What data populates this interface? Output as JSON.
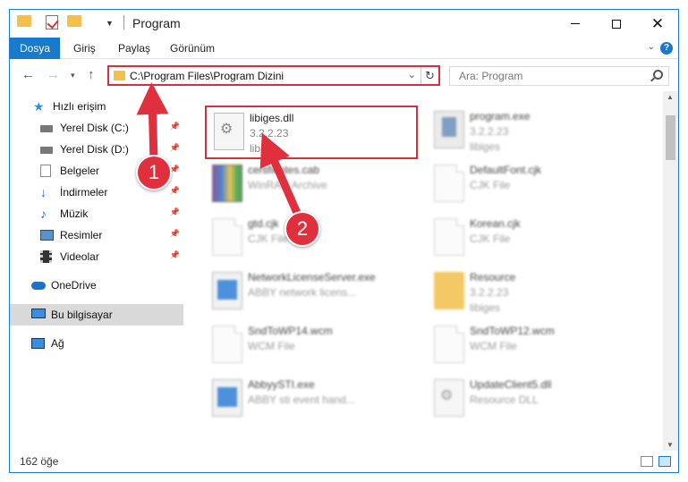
{
  "window": {
    "title": "Program"
  },
  "ribbon": {
    "tabs": [
      "Dosya",
      "Giriş",
      "Paylaş",
      "Görünüm"
    ]
  },
  "address": {
    "path": "C:\\Program Files\\Program Dizini",
    "search_placeholder": "Ara: Program"
  },
  "sidebar": {
    "items": [
      {
        "label": "Hızlı erişim",
        "icon": "star-icon"
      },
      {
        "label": "Yerel Disk (C:)",
        "icon": "drive-icon"
      },
      {
        "label": "Yerel Disk (D:)",
        "icon": "drive-icon"
      },
      {
        "label": "Belgeler",
        "icon": "documents-icon"
      },
      {
        "label": "İndirmeler",
        "icon": "download-icon"
      },
      {
        "label": "Müzik",
        "icon": "music-icon"
      },
      {
        "label": "Resimler",
        "icon": "pictures-icon"
      },
      {
        "label": "Videolar",
        "icon": "videos-icon"
      },
      {
        "label": "OneDrive",
        "icon": "cloud-icon"
      },
      {
        "label": "Bu bilgisayar",
        "icon": "computer-icon"
      },
      {
        "label": "Ağ",
        "icon": "network-icon"
      }
    ]
  },
  "files": [
    {
      "name": "libiges.dll",
      "line2": "3.2.2.23",
      "line3": "libiges",
      "icon": "dll-gear-icon"
    },
    {
      "name": "program.exe",
      "line2": "3.2.2.23",
      "line3": "libiges",
      "icon": "program-icon"
    },
    {
      "name": "certificates.cab",
      "line2": "WinRAR Archive",
      "line3": "",
      "icon": "archive-icon"
    },
    {
      "name": "DefaultFont.cjk",
      "line2": "CJK File",
      "line3": "",
      "icon": "document-icon"
    },
    {
      "name": "gtd.cjk",
      "line2": "CJK File",
      "line3": "",
      "icon": "document-icon"
    },
    {
      "name": "Korean.cjk",
      "line2": "CJK File",
      "line3": "",
      "icon": "document-icon"
    },
    {
      "name": "NetworkLicenseServer.exe",
      "line2": "ABBY network licens...",
      "line3": "",
      "icon": "exe-icon"
    },
    {
      "name": "Resource",
      "line2": "3.2.2.23",
      "line3": "libiges",
      "icon": "folder-icon"
    },
    {
      "name": "SndToWP14.wcm",
      "line2": "WCM File",
      "line3": "",
      "icon": "document-icon"
    },
    {
      "name": "SndToWP12.wcm",
      "line2": "WCM File",
      "line3": "",
      "icon": "document-icon"
    },
    {
      "name": "AbbyySTI.exe",
      "line2": "ABBY sti event hand...",
      "line3": "",
      "icon": "exe-icon"
    },
    {
      "name": "UpdateClient5.dll",
      "line2": "Resource DLL",
      "line3": "",
      "icon": "dll-gear-icon"
    }
  ],
  "status": {
    "count": "162 öğe"
  },
  "annotations": {
    "step1": "1",
    "step2": "2"
  },
  "colors": {
    "accent": "#1979ca",
    "highlight": "#d72f3c",
    "annotation": "#e0303e"
  }
}
